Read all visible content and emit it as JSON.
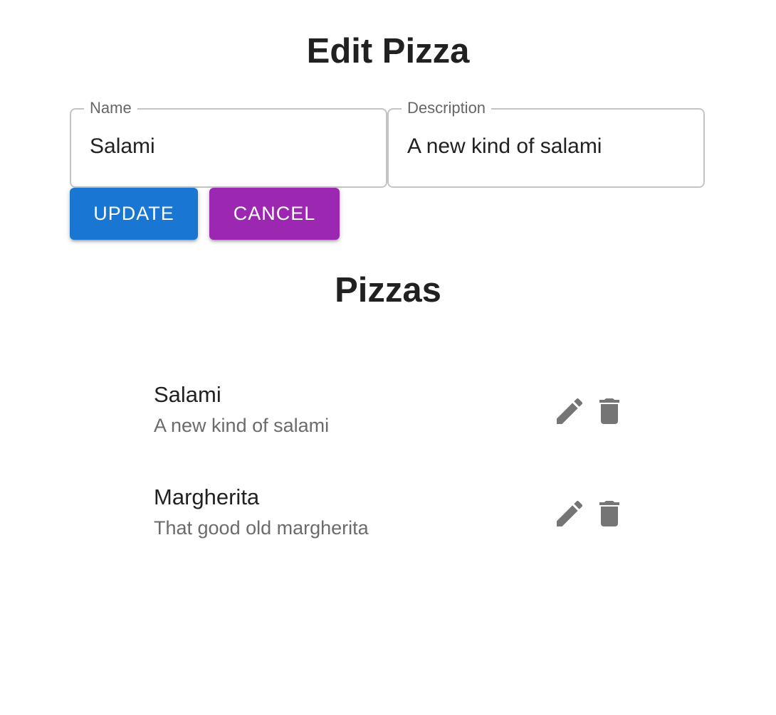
{
  "edit_form": {
    "title": "Edit Pizza",
    "name_label": "Name",
    "name_value": "Salami",
    "description_label": "Description",
    "description_value": "A new kind of salami",
    "update_label": "Update",
    "cancel_label": "Cancel"
  },
  "list": {
    "title": "Pizzas",
    "items": [
      {
        "name": "Salami",
        "description": "A new kind of salami",
        "edit_icon": "pencil-icon",
        "delete_icon": "trash-icon"
      },
      {
        "name": "Margherita",
        "description": "That good old margherita",
        "edit_icon": "pencil-icon",
        "delete_icon": "trash-icon"
      }
    ]
  },
  "colors": {
    "primary": "#1976d2",
    "secondary": "#9c27b0",
    "icon": "#757575",
    "outline": "#c4c4c4"
  }
}
